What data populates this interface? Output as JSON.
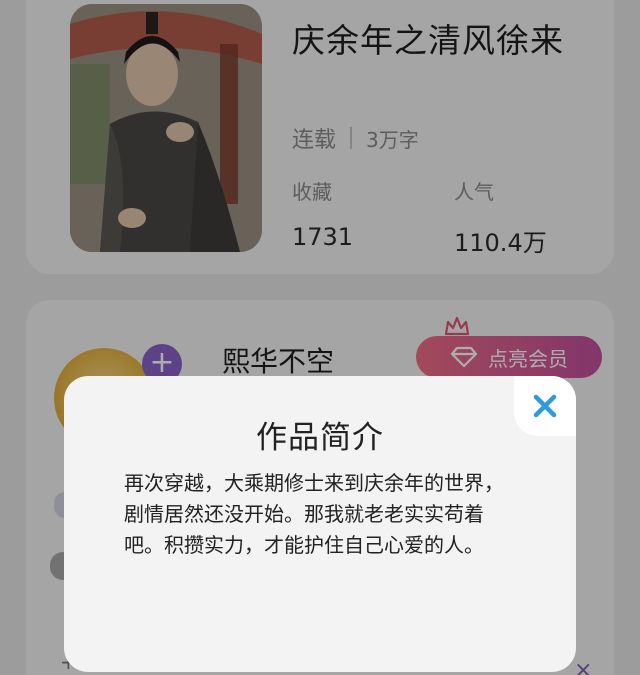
{
  "book": {
    "title": "庆余年之清风徐来",
    "status": "连载",
    "word_count": "3万字",
    "favorites_label": "收藏",
    "favorites_value": "1731",
    "popularity_label": "人气",
    "popularity_value": "110.4万"
  },
  "author": {
    "name": "熙华不空",
    "follow_symbol": "+",
    "vip_button_label": "点亮会员"
  },
  "background_glyphs": {
    "plus": "+",
    "close": "×"
  },
  "modal": {
    "title": "作品简介",
    "description": "再次穿越，大乘期修士来到庆余年的世界，剧情居然还没开始。那我就老老实实苟着吧。积攒实力，才能护住自己心爱的人。",
    "close_icon": "close-icon"
  },
  "colors": {
    "close_icon": "#2e9be0",
    "vip_gradient_start": "#ef6d86",
    "vip_gradient_end": "#c24f9f",
    "follow_button": "#8a62c8"
  }
}
